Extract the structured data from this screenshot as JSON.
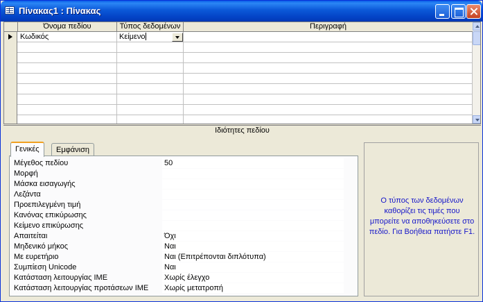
{
  "window": {
    "title": "Πίνακας1 : Πίνακας"
  },
  "grid": {
    "columns": [
      "Όνομα πεδίου",
      "Τύπος δεδομένων",
      "Περιγραφή"
    ],
    "rows": [
      {
        "field_name": "Κωδικός",
        "data_type": "Κείμενο",
        "description": ""
      }
    ]
  },
  "field_properties": {
    "title": "Ιδιότητες πεδίου",
    "tabs": [
      "Γενικές",
      "Εμφάνιση"
    ],
    "properties": [
      {
        "label": "Μέγεθος πεδίου",
        "value": "50"
      },
      {
        "label": "Μορφή",
        "value": ""
      },
      {
        "label": "Μάσκα εισαγωγής",
        "value": ""
      },
      {
        "label": "Λεζάντα",
        "value": ""
      },
      {
        "label": "Προεπιλεγμένη τιμή",
        "value": ""
      },
      {
        "label": "Κανόνας επικύρωσης",
        "value": ""
      },
      {
        "label": "Κείμενο επικύρωσης",
        "value": ""
      },
      {
        "label": "Απαιτείται",
        "value": "Όχι"
      },
      {
        "label": "Μηδενικό μήκος",
        "value": "Ναι"
      },
      {
        "label": "Με ευρετήριο",
        "value": "Ναι (Επιτρέπονται διπλότυπα)"
      },
      {
        "label": "Συμπίεση Unicode",
        "value": "Ναι"
      },
      {
        "label": "Κατάσταση λειτουργίας IME",
        "value": "Χωρίς έλεγχο"
      },
      {
        "label": "Κατάσταση λειτουργίας προτάσεων IME",
        "value": "Χωρίς μετατροπή"
      }
    ],
    "help_text": "Ο τύπος των δεδομένων καθορίζει τις τιμές που μπορείτε να αποθηκεύσετε στο πεδίο. Για Βοήθεια πατήστε F1."
  },
  "colors": {
    "titlebar": "#0342c5",
    "help_text": "#1515c9",
    "active_tab_accent": "#f0a020"
  }
}
